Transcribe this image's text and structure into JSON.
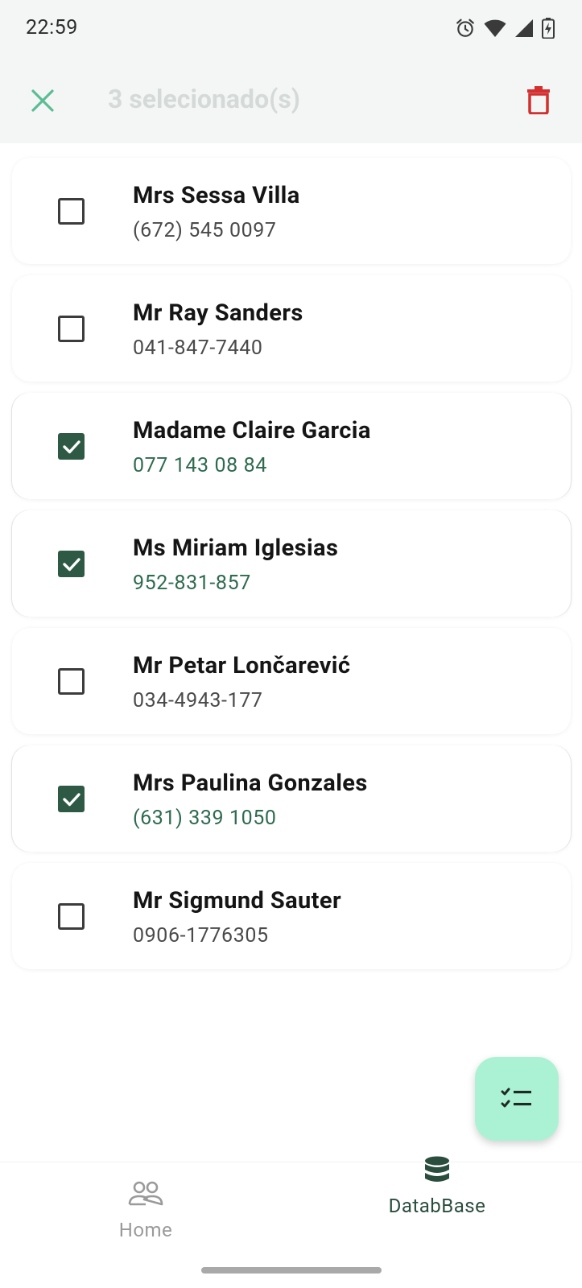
{
  "status_bar": {
    "time": "22:59",
    "icons": [
      "alarm-icon",
      "wifi-icon",
      "signal-icon",
      "battery-charging-icon"
    ]
  },
  "app_bar": {
    "close_icon": "close-icon",
    "title": "3 selecionado(s)",
    "delete_icon": "delete-icon"
  },
  "colors": {
    "accent_dark": "#2e5a45",
    "accent_light": "#abf2d4",
    "close_icon": "#5bbd94",
    "delete_icon": "#d32f2f",
    "title_muted": "#d5dad8"
  },
  "contacts": [
    {
      "name": "Mrs Sessa Villa",
      "phone": "(672) 545 0097",
      "selected": false
    },
    {
      "name": "Mr Ray Sanders",
      "phone": "041-847-7440",
      "selected": false
    },
    {
      "name": "Madame Claire Garcia",
      "phone": "077 143 08 84",
      "selected": true
    },
    {
      "name": "Ms Miriam Iglesias",
      "phone": "952-831-857",
      "selected": true
    },
    {
      "name": "Mr Petar Lončarević",
      "phone": "034-4943-177",
      "selected": false
    },
    {
      "name": "Mrs Paulina Gonzales",
      "phone": "(631) 339 1050",
      "selected": true
    },
    {
      "name": "Mr Sigmund Sauter",
      "phone": "0906-1776305",
      "selected": false
    }
  ],
  "fab": {
    "icon": "checklist-icon"
  },
  "bottom_nav": {
    "items": [
      {
        "label": "Home",
        "icon": "people-icon",
        "active": false
      },
      {
        "label": "DatabBase",
        "icon": "database-icon",
        "active": true
      }
    ]
  }
}
